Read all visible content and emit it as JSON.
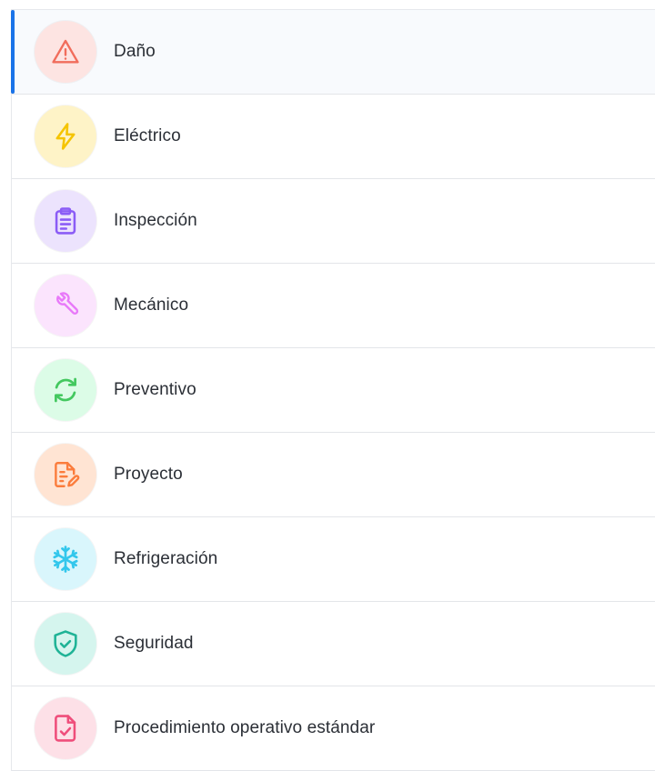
{
  "categories": [
    {
      "label": "Daño",
      "icon": "warning-icon",
      "bg": "#fde4e2",
      "color": "#f16d5c",
      "selected": true
    },
    {
      "label": "Eléctrico",
      "icon": "lightning-icon",
      "bg": "#fef3c7",
      "color": "#f5c400",
      "selected": false
    },
    {
      "label": "Inspección",
      "icon": "clipboard-icon",
      "bg": "#ece3fd",
      "color": "#8b5cf6",
      "selected": false
    },
    {
      "label": "Mecánico",
      "icon": "wrench-icon",
      "bg": "#fbe4fd",
      "color": "#e879f9",
      "selected": false
    },
    {
      "label": "Preventivo",
      "icon": "refresh-icon",
      "bg": "#dcfce7",
      "color": "#43c85f",
      "selected": false
    },
    {
      "label": "Proyecto",
      "icon": "document-edit-icon",
      "bg": "#ffe4d3",
      "color": "#fb7c3c",
      "selected": false
    },
    {
      "label": "Refrigeración",
      "icon": "snowflake-icon",
      "bg": "#d9f6fc",
      "color": "#33c7ec",
      "selected": false
    },
    {
      "label": "Seguridad",
      "icon": "shield-check-icon",
      "bg": "#d5f5ee",
      "color": "#1fb396",
      "selected": false
    },
    {
      "label": "Procedimiento operativo estándar",
      "icon": "file-check-icon",
      "bg": "#fde0e7",
      "color": "#ef4e7b",
      "selected": false
    }
  ]
}
